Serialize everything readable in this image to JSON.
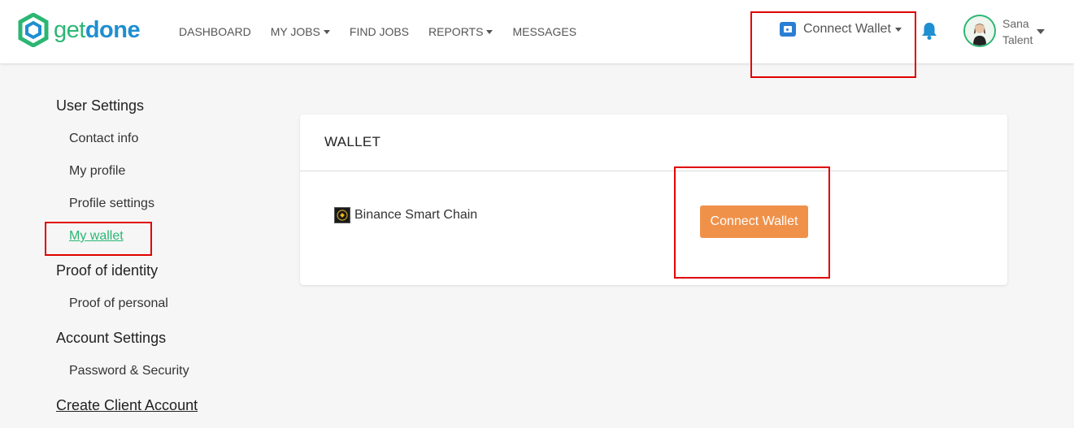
{
  "header": {
    "logo": {
      "get": "get",
      "done": "done"
    },
    "nav": [
      {
        "label": "DASHBOARD",
        "dropdown": false
      },
      {
        "label": "MY JOBS",
        "dropdown": true
      },
      {
        "label": "FIND JOBS",
        "dropdown": false
      },
      {
        "label": "REPORTS",
        "dropdown": true
      },
      {
        "label": "MESSAGES",
        "dropdown": false
      }
    ],
    "wallet_label": "Connect Wallet",
    "user": {
      "first": "Sana",
      "role": "Talent"
    }
  },
  "sidebar": {
    "user_settings_heading": "User Settings",
    "user_settings_items": [
      "Contact info",
      "My profile",
      "Profile settings",
      "My wallet"
    ],
    "proof_heading": "Proof of identity",
    "proof_items": [
      "Proof of personal"
    ],
    "account_heading": "Account Settings",
    "account_items": [
      "Password & Security"
    ],
    "create_client_link": "Create Client Account"
  },
  "wallet_card": {
    "title": "WALLET",
    "chain_name": "Binance Smart Chain",
    "connect_button": "Connect Wallet"
  },
  "colors": {
    "brand_green": "#2bb673",
    "brand_blue": "#1e8fd0",
    "button_orange": "#f0914a",
    "highlight_red": "#e00000"
  }
}
